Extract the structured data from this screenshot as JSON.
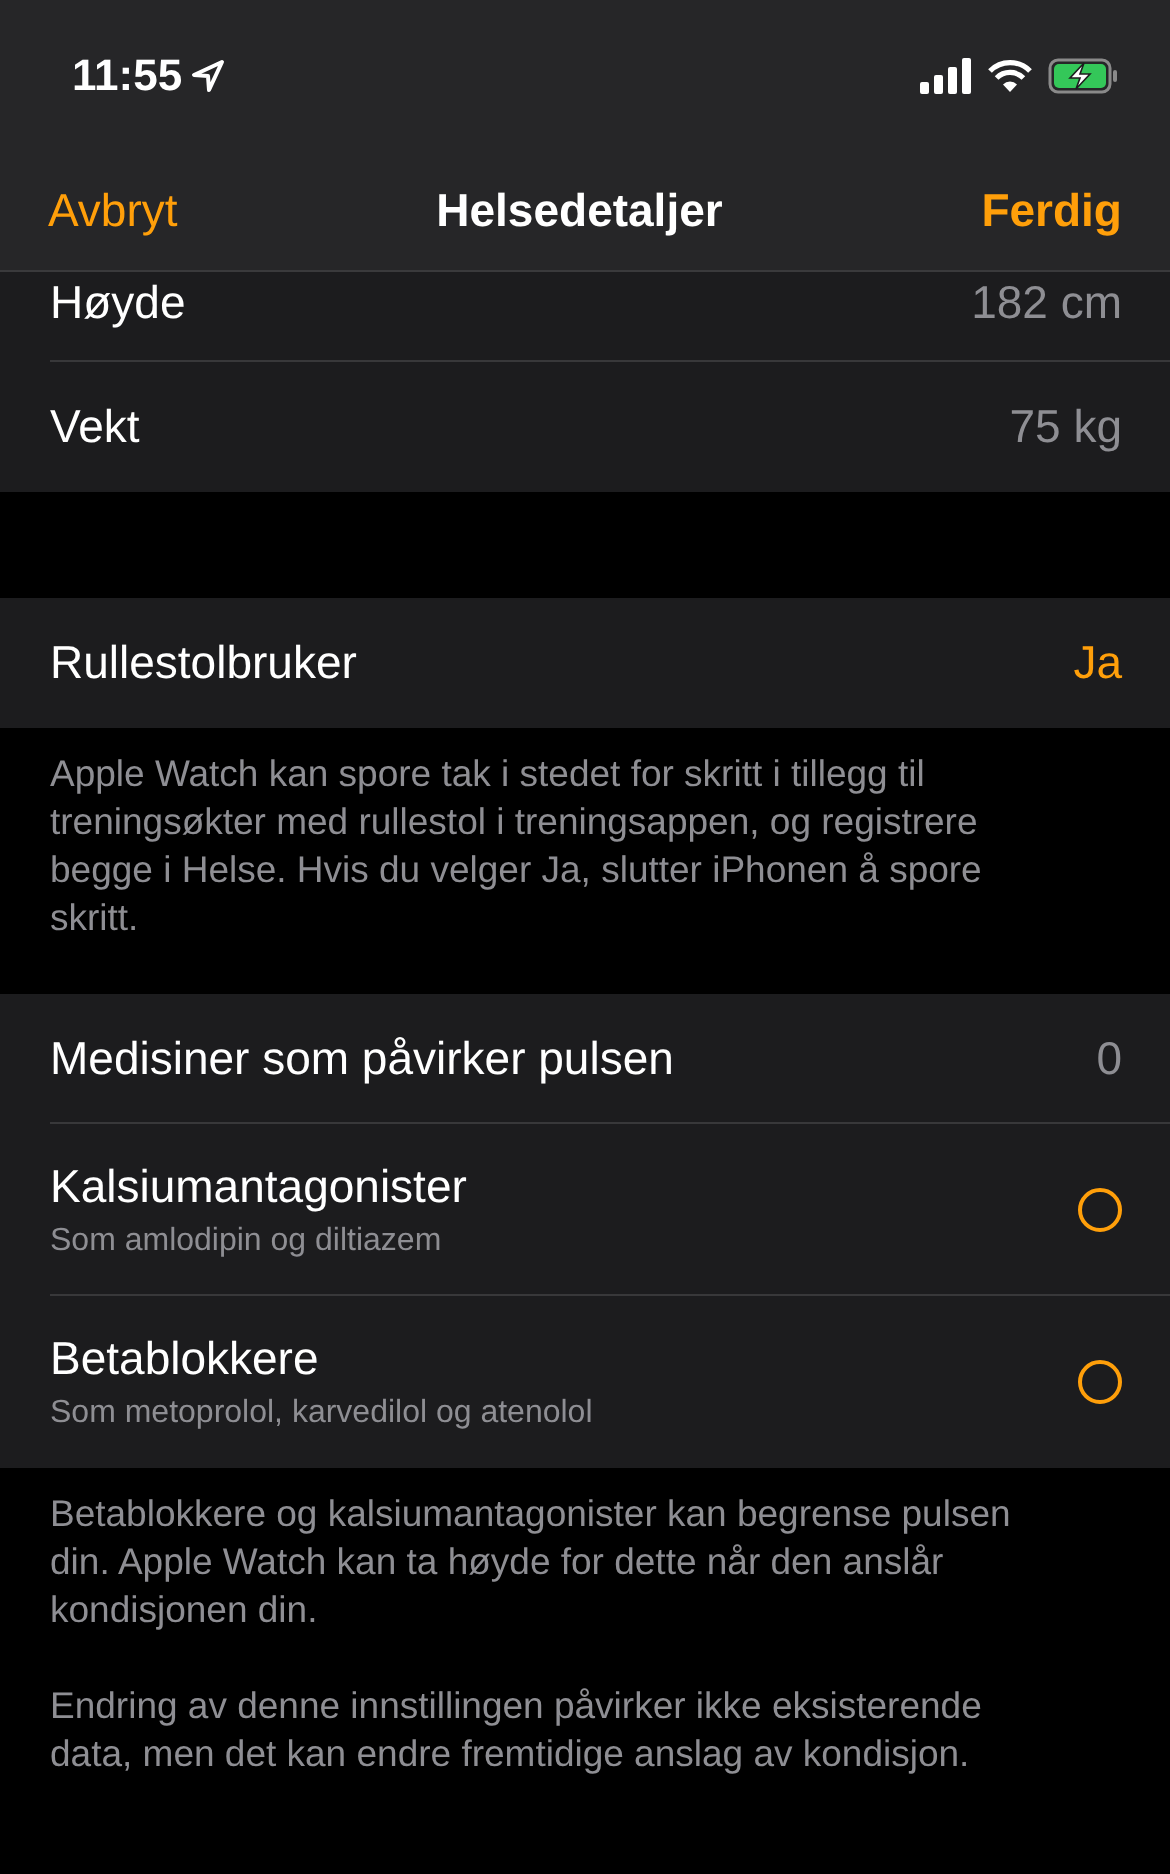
{
  "status_bar": {
    "time": "11:55"
  },
  "nav": {
    "cancel": "Avbryt",
    "title": "Helsedetaljer",
    "done": "Ferdig"
  },
  "sections": [
    {
      "rows": [
        {
          "kind": "value",
          "label": "Høyde",
          "value": "182 cm",
          "partial": true
        },
        {
          "kind": "value",
          "label": "Vekt",
          "value": "75 kg",
          "partial": false
        }
      ]
    },
    {
      "rows": [
        {
          "kind": "value",
          "label": "Rullestolbruker",
          "value": "Ja",
          "accent": true
        }
      ],
      "footer": [
        "Apple Watch kan spore tak i stedet for skritt i tillegg til treningsøkter med rullestol i treningsappen, og registrere begge i Helse. Hvis du velger Ja, slutter iPhonen å spore skritt."
      ]
    },
    {
      "rows": [
        {
          "kind": "value",
          "label": "Medisiner som påvirker pulsen",
          "value": "0",
          "accent": false
        },
        {
          "kind": "option",
          "label": "Kalsiumantagonister",
          "subtitle": "Som amlodipin og diltiazem",
          "checked": false
        },
        {
          "kind": "option",
          "label": "Betablokkere",
          "subtitle": "Som metoprolol, karvedilol og atenolol",
          "checked": false
        }
      ],
      "footer": [
        "Betablokkere og kalsiumantagonister kan begrense pulsen din. Apple Watch kan ta høyde for dette når den anslår kondisjonen din.",
        "Endring av denne innstillingen påvirker ikke eksisterende data, men det kan endre fremtidige anslag av kondisjon."
      ]
    }
  ]
}
